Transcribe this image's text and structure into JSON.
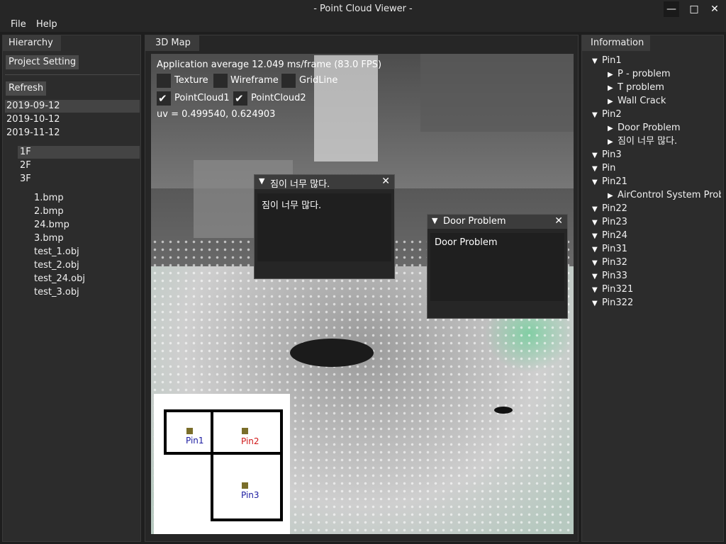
{
  "window": {
    "title": "- Point Cloud Viewer -",
    "min_icon": "minimize-icon",
    "max_icon": "maximize-icon",
    "close_icon": "close-icon"
  },
  "menu": {
    "file": "File",
    "help": "Help"
  },
  "hierarchy": {
    "tab": "Hierarchy",
    "project_setting": "Project Setting",
    "refresh": "Refresh",
    "dates": [
      "2019-09-12",
      "2019-10-12",
      "2019-11-12"
    ],
    "floors": [
      "1F",
      "2F",
      "3F"
    ],
    "files": [
      "1.bmp",
      "2.bmp",
      "24.bmp",
      "3.bmp",
      "test_1.obj",
      "test_2.obj",
      "test_24.obj",
      "test_3.obj"
    ]
  },
  "map3d": {
    "tab": "3D Map",
    "fps_text": "Application average 12.049 ms/frame (83.0 FPS)",
    "uv_text": "uv = 0.499540, 0.624903",
    "options": {
      "texture": {
        "label": "Texture",
        "checked": false
      },
      "wireframe": {
        "label": "Wireframe",
        "checked": false
      },
      "gridline": {
        "label": "GridLine",
        "checked": false
      },
      "pointcloud1": {
        "label": "PointCloud1",
        "checked": true
      },
      "pointcloud2": {
        "label": "PointCloud2",
        "checked": true
      }
    },
    "popups": [
      {
        "title": "짐이 너무 많다.",
        "body": "짐이 너무 많다."
      },
      {
        "title": "Door Problem",
        "body": "Door Problem"
      }
    ],
    "minimap": {
      "pins": [
        {
          "label": "Pin1",
          "color": "#1a1aa0"
        },
        {
          "label": "Pin2",
          "color": "#d01818"
        },
        {
          "label": "Pin3",
          "color": "#1a1aa0"
        }
      ]
    }
  },
  "information": {
    "tab": "Information",
    "tree": [
      {
        "label": "Pin1",
        "children": [
          "P - problem",
          "T problem",
          "Wall Crack"
        ]
      },
      {
        "label": "Pin2",
        "children": [
          "Door Problem",
          "짐이 너무 많다."
        ]
      },
      {
        "label": "Pin3",
        "children": []
      },
      {
        "label": "Pin",
        "children": []
      },
      {
        "label": "Pin21",
        "children": [
          "AirControl System Proble"
        ]
      },
      {
        "label": "Pin22",
        "children": []
      },
      {
        "label": "Pin23",
        "children": []
      },
      {
        "label": "Pin24",
        "children": []
      },
      {
        "label": "Pin31",
        "children": []
      },
      {
        "label": "Pin32",
        "children": []
      },
      {
        "label": "Pin33",
        "children": []
      },
      {
        "label": "Pin321",
        "children": []
      },
      {
        "label": "Pin322",
        "children": []
      }
    ]
  }
}
